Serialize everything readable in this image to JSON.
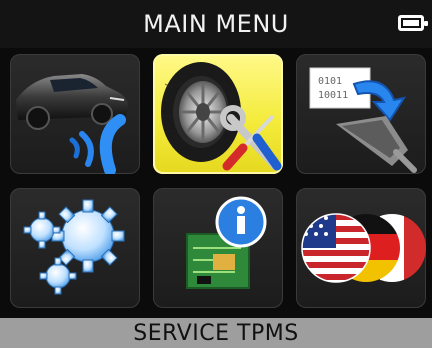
{
  "header": {
    "title": "MAIN MENU",
    "battery_icon": "battery-icon"
  },
  "menu": {
    "tiles": [
      {
        "id": "activate-sensor",
        "icon": "car-signal-icon",
        "selected": false
      },
      {
        "id": "service-tpms",
        "icon": "tire-tools-icon",
        "selected": true
      },
      {
        "id": "program-sensor",
        "icon": "sensor-program-icon",
        "selected": false
      },
      {
        "id": "settings",
        "icon": "gears-icon",
        "selected": false
      },
      {
        "id": "info",
        "icon": "info-board-icon",
        "selected": false
      },
      {
        "id": "language",
        "icon": "flags-icon",
        "selected": false
      }
    ]
  },
  "footer": {
    "label": "SERVICE TPMS"
  },
  "colors": {
    "selected_tile": "#f4ec3d",
    "tile": "#222222",
    "footer_bg": "#9e9e9e",
    "header_bg": "#141414"
  }
}
